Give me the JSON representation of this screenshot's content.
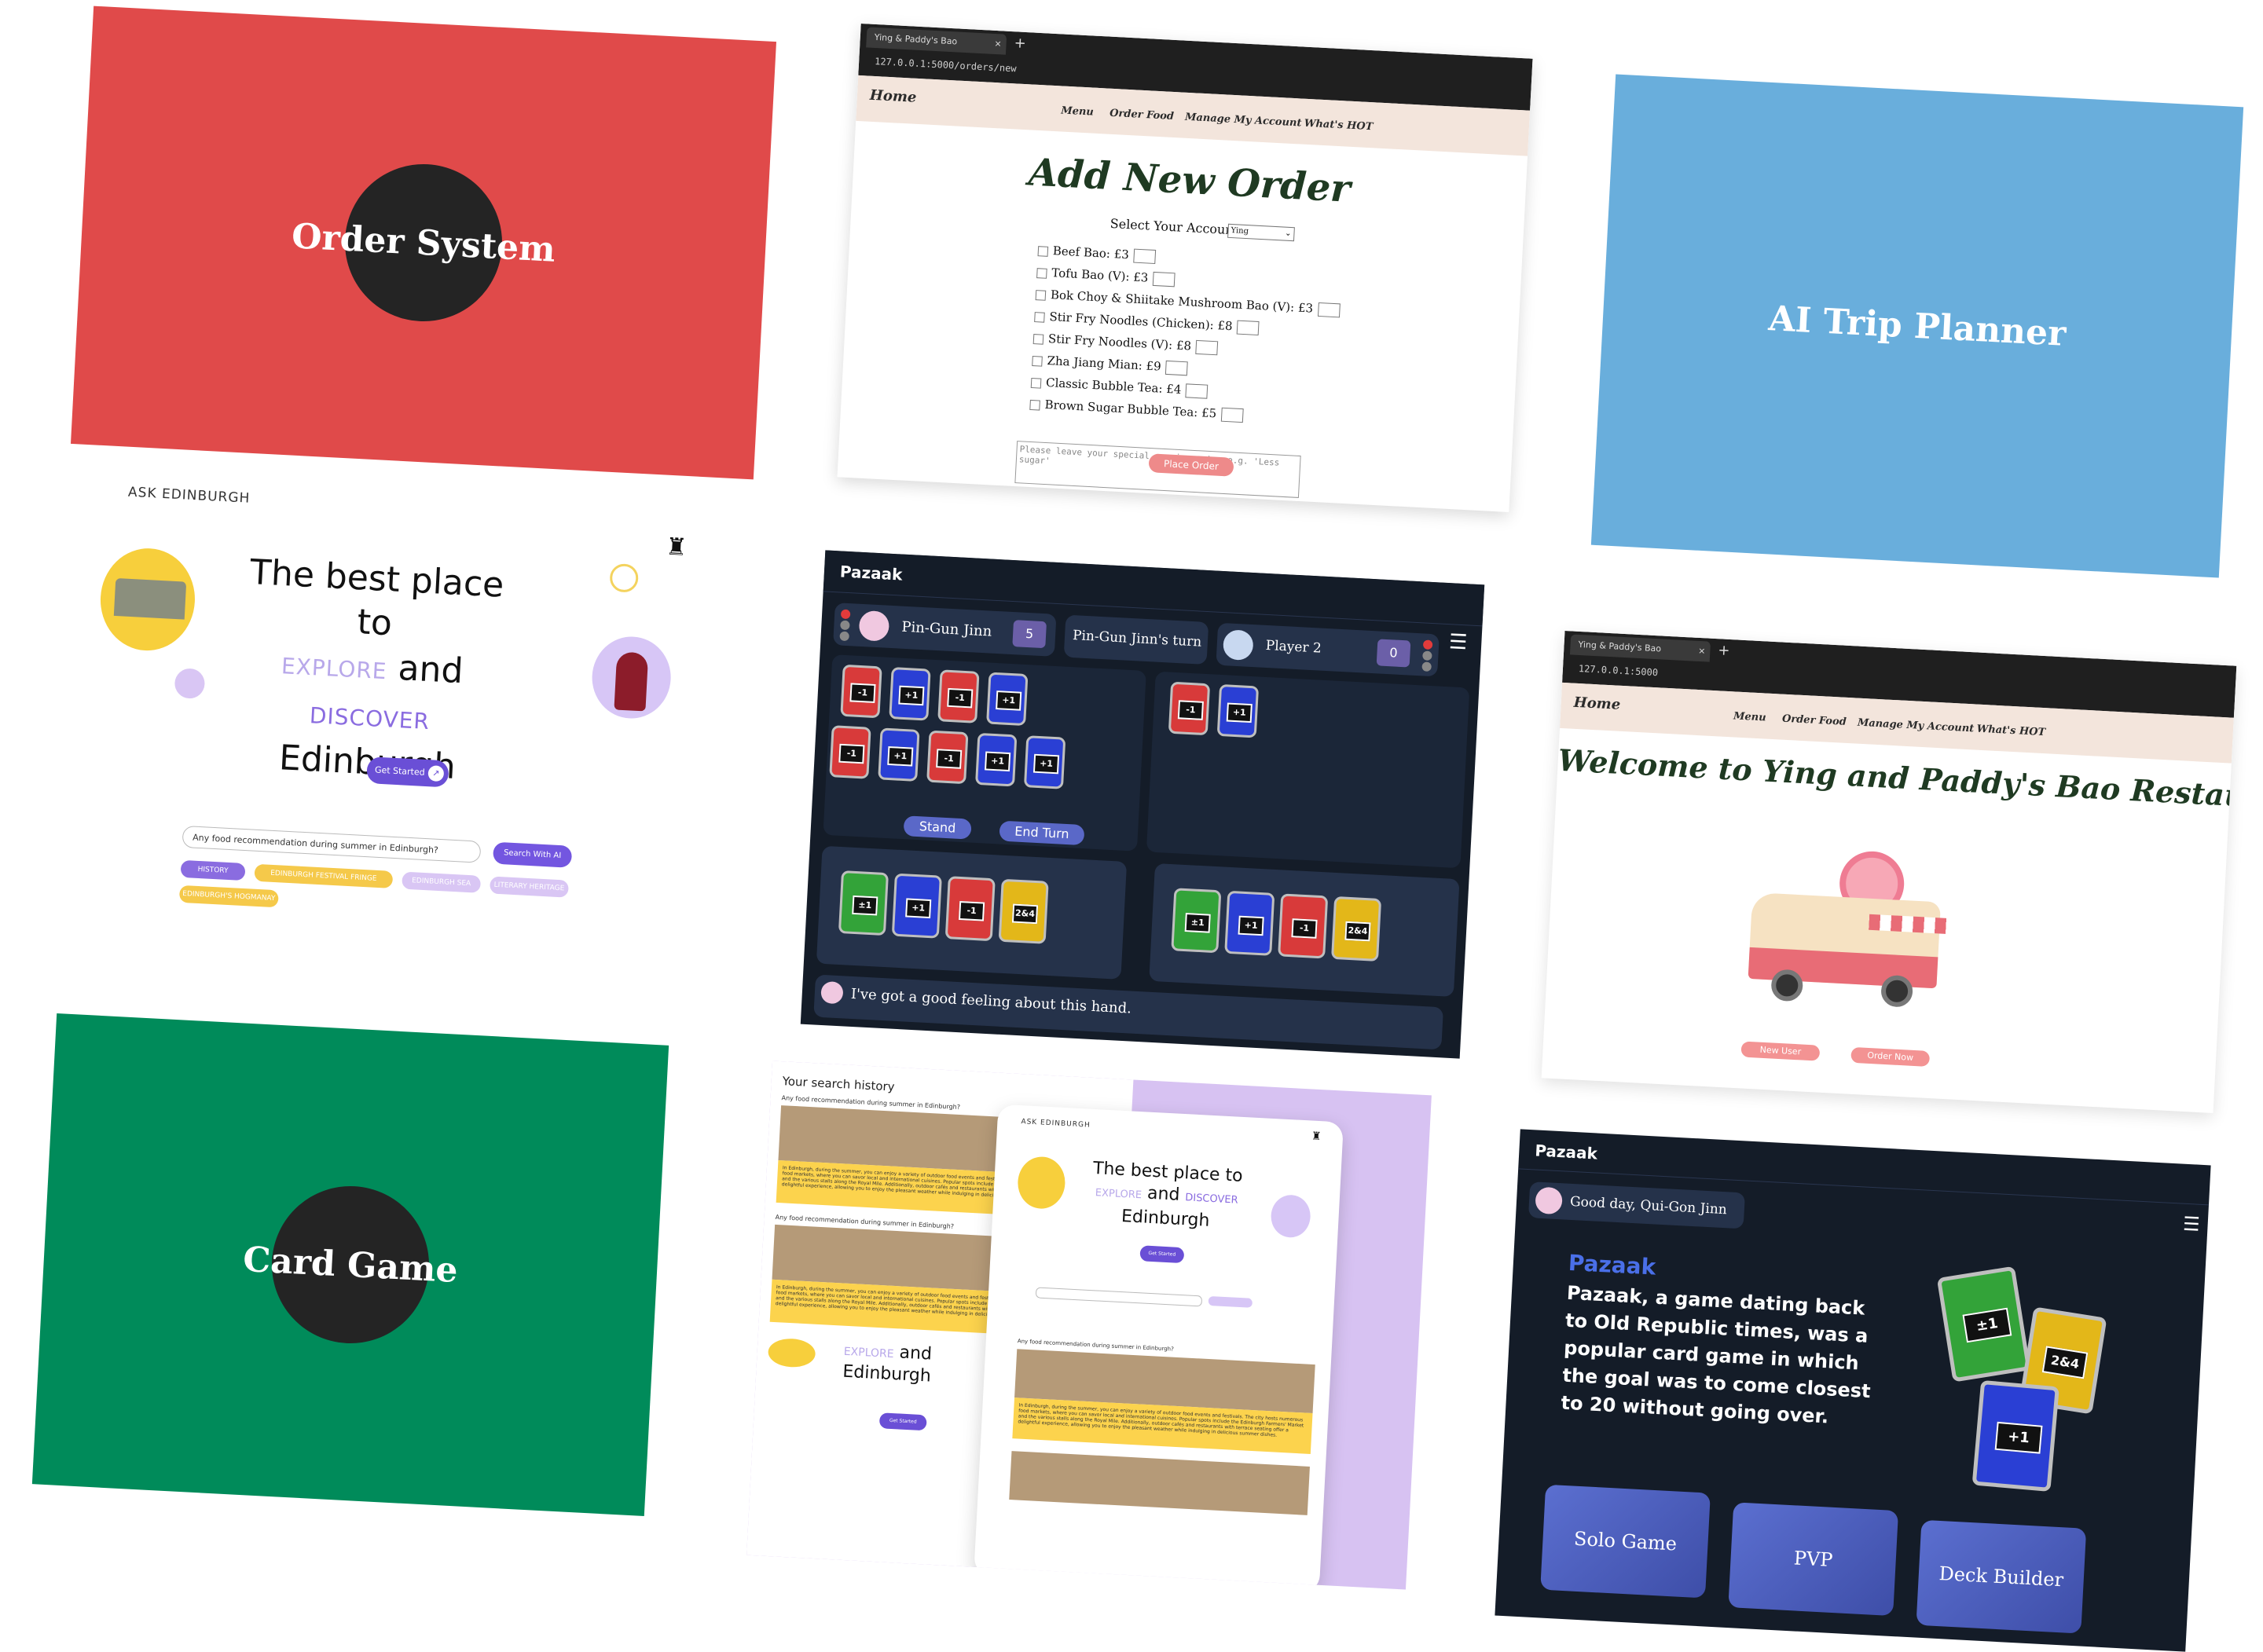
{
  "order_card": {
    "title": "Order System",
    "bg": "#e04a4a"
  },
  "trip_card": {
    "title": "AI Trip Planner",
    "bg": "#69aedc"
  },
  "game_card": {
    "title": "Card Game",
    "bg": "#008b5a"
  },
  "order_page": {
    "tab_title": "Ying & Paddy's Bao",
    "tab_close": "×",
    "new_tab": "+",
    "url": "127.0.0.1:5000/orders/new",
    "nav": {
      "home": "Home",
      "menu": "Menu",
      "order_food": "Order Food",
      "manage": "Manage My Account",
      "hot": "What's HOT"
    },
    "heading": "Add New Order",
    "account_label": "Select Your Account",
    "account_value": "Ying",
    "items": [
      "Beef Bao: £3",
      "Tofu Bao (V): £3",
      "Bok Choy & Shiitake Mushroom Bao (V): £3",
      "Stir Fry Noodles (Chicken): £8",
      "Stir Fry Noodles (V): £8",
      "Zha Jiang Mian: £9",
      "Classic Bubble Tea: £4",
      "Brown Sugar Bubble Tea: £5"
    ],
    "requirements_placeholder": "Please leave your special requirements, e.g. 'Less sugar'",
    "submit": "Place Order"
  },
  "ask_edinburgh": {
    "logo": "ASK EDINBURGH",
    "headline_1": "The best place to",
    "explore": "EXPLORE",
    "and": "and",
    "discover": "DISCOVER",
    "headline_3": "Edinburgh",
    "cta": "Get Started",
    "search_value": "Any food recommendation during summer in Edinburgh?",
    "search_button": "Search With AI",
    "chips": [
      "HISTORY",
      "EDINBURGH FESTIVAL FRINGE",
      "EDINBURGH SEA WEEK",
      "LITERARY HERITAGE",
      "EDINBURGH'S HOGMANAY"
    ]
  },
  "pazaak_game": {
    "brand": "Pazaak",
    "player1": "Pin-Gun Jinn",
    "player1_score": "5",
    "turn_text": "Pin-Gun Jinn's turn",
    "player2": "Player 2",
    "player2_score": "0",
    "board1_row1": [
      "-1",
      "+1",
      "-1",
      "+1"
    ],
    "board1_row2": [
      "-1",
      "+1",
      "-1",
      "+1",
      "+1"
    ],
    "board2": [
      "-1",
      "+1"
    ],
    "stand": "Stand",
    "end_turn": "End Turn",
    "hand1": [
      "±1",
      "+1",
      "-1",
      "2&4"
    ],
    "hand2": [
      "±1",
      "+1",
      "-1",
      "2&4"
    ],
    "chat": "I've got a good feeling about this hand."
  },
  "bao_welcome": {
    "tab_title": "Ying & Paddy's Bao",
    "tab_close": "×",
    "new_tab": "+",
    "url": "127.0.0.1:5000",
    "nav": {
      "home": "Home",
      "menu": "Menu",
      "order_food": "Order Food",
      "manage": "Manage My Account",
      "hot": "What's HOT"
    },
    "heading": "Welcome to Ying and Paddy's Bao Restaurant",
    "new_user": "New User",
    "order_now": "Order Now"
  },
  "ask_mobile": {
    "history_title": "Your search history",
    "query": "Any food recommendation during summer in Edinburgh?",
    "answer": "In Edinburgh, during the summer, you can enjoy a variety of outdoor food events and festivals. The city hosts numerous food markets, where you can savor local and international cuisines. Popular spots include the Edinburgh Farmers' Market and the various stalls along the Royal Mile. Additionally, outdoor cafés and restaurants with terrace seating offer a delightful experience, allowing you to enjoy the pleasant weather while indulging in delicious summer dishes.",
    "logo": "ASK EDINBURGH",
    "headline_1": "The best place to",
    "explore": "EXPLORE",
    "and": "and",
    "discover": "DISCOVER",
    "headline_3": "Edinburgh",
    "cta": "Get Started"
  },
  "pazaak_menu": {
    "brand": "Pazaak",
    "greeting": "Good day, Qui-Gon Jinn",
    "title": "Pazaak",
    "description": "Pazaak, a game dating back to Old Republic times, was a popular card game in which the goal was to come closest to 20 without going over.",
    "cards": [
      "±1",
      "2&4",
      "+1"
    ],
    "buttons": [
      "Solo Game",
      "PVP",
      "Deck Builder"
    ]
  }
}
